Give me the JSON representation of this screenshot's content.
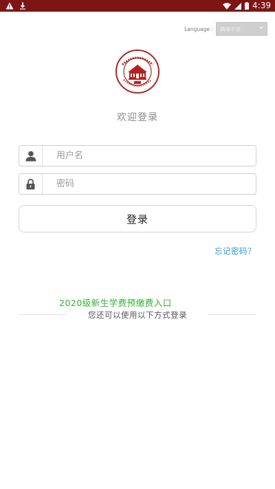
{
  "status_bar": {
    "time": "4:39",
    "background": "#7d1515",
    "icons": [
      "warning-icon",
      "download-icon",
      "wifi-icon",
      "cellular-icon",
      "battery-icon"
    ]
  },
  "language": {
    "label": "Language :",
    "selected": "简体中文"
  },
  "logo": {
    "name": "university-emblem",
    "color": "#b22222"
  },
  "welcome_text": "欢迎登录",
  "username_field": {
    "placeholder": "用户名",
    "value": "",
    "icon": "user-icon"
  },
  "password_field": {
    "placeholder": "密码",
    "value": "",
    "icon": "lock-icon"
  },
  "login_button": {
    "label": "登录"
  },
  "forgot_password": "忘记密码？",
  "fee_entry_link": "2020级新生学费预缴费入口",
  "other_login_text": "您还可以使用以下方式登录",
  "colors": {
    "accent_link": "#2a9bd6",
    "fee_link": "#2fb12f",
    "brand": "#7d1515"
  }
}
